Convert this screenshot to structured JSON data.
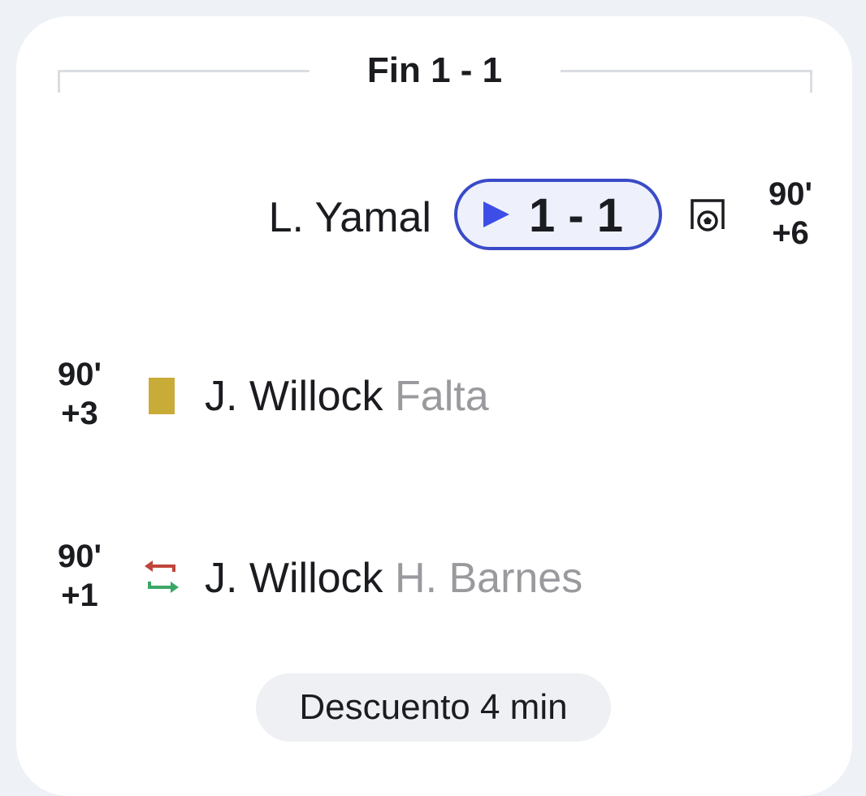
{
  "header": {
    "status": "Fin 1 - 1"
  },
  "events": {
    "goal": {
      "player": "L. Yamal",
      "score": "1 - 1",
      "minute": "90'",
      "added": "+6",
      "icon": "goal-icon"
    },
    "yellow_card": {
      "player": "J. Willock",
      "reason": "Falta",
      "minute": "90'",
      "added": "+3",
      "color": "#c9ab38",
      "icon": "yellow-card-icon"
    },
    "substitution": {
      "player_in": "J. Willock",
      "player_out": "H. Barnes",
      "minute": "90'",
      "added": "+1",
      "colors": {
        "out": "#c0453a",
        "in": "#3aa766"
      },
      "icon": "substitution-icon"
    }
  },
  "added_time": {
    "label": "Descuento 4 min"
  },
  "colors": {
    "accent": "#3d4ee6",
    "pill_border": "#3a4bc8",
    "text": "#1b1c20",
    "muted": "#9a9a9e"
  }
}
